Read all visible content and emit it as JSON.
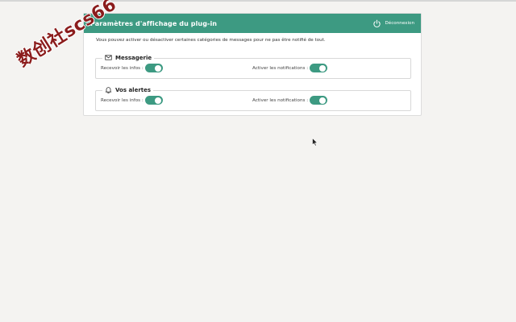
{
  "panel": {
    "title": "Paramètres d'affichage du plug-in",
    "logout_label": "Déconnexion",
    "intro": "Vous pouvez activer ou désactiver certaines catégories de messages pour ne pas être notifié de tout."
  },
  "sections": [
    {
      "title": "Messagerie",
      "icon": "mail-icon",
      "left_label": "Recevoir les infos :",
      "left_enabled": true,
      "right_label": "Activer les notifications :",
      "right_enabled": true
    },
    {
      "title": "Vos alertes",
      "icon": "bell-icon",
      "left_label": "Recevoir les infos :",
      "left_enabled": true,
      "right_label": "Activer les notifications :",
      "right_enabled": true
    }
  ],
  "watermark": "数创社scs66",
  "colors": {
    "accent": "#3d9a82",
    "background": "#f4f3f1",
    "watermark": "#8b1c1c"
  }
}
